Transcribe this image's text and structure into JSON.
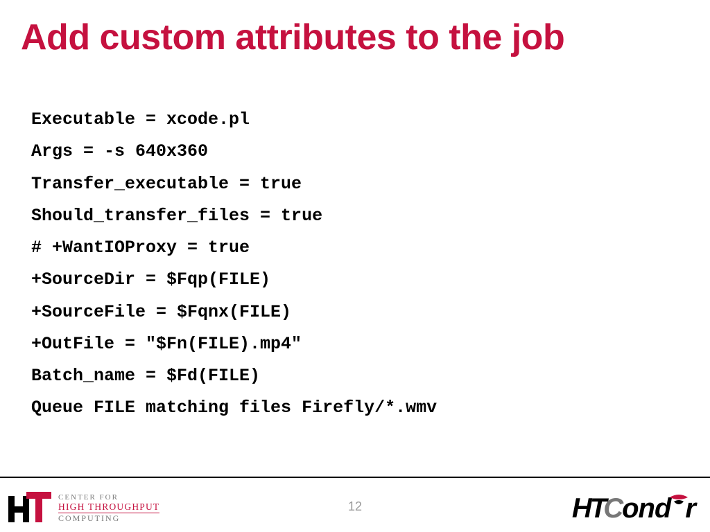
{
  "title": "Add custom attributes to the job",
  "code_lines": [
    "Executable = xcode.pl",
    "Args = -s 640x360",
    "Transfer_executable = true",
    "Should_transfer_files = true",
    "# +WantIOProxy = true",
    "+SourceDir = $Fqp(FILE)",
    "+SourceFile = $Fqnx(FILE)",
    "+OutFile = \"$Fn(FILE).mp4\"",
    "Batch_name = $Fd(FILE)",
    "Queue FILE matching files Firefly/*.wmv"
  ],
  "page_number": "12",
  "logo_left": {
    "line1": "CENTER FOR",
    "line2": "HIGH THROUGHPUT",
    "line3": "COMPUTING"
  },
  "logo_right": {
    "part_ht": "HT",
    "part_c": "C",
    "part_ond": "ond",
    "part_r": "r"
  }
}
